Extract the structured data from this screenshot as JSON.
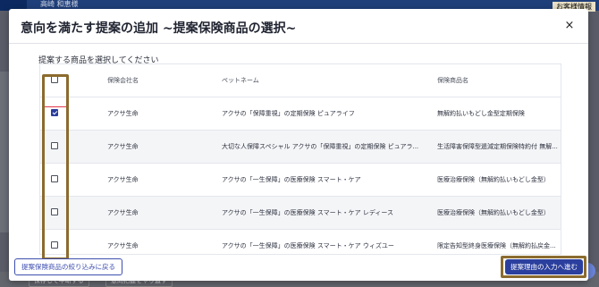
{
  "background": {
    "user_name": "高崎 和恵様",
    "right_badge": "お客様情報",
    "bottom_button_1": "保存して中断する",
    "bottom_button_2": "意向把握をやり直す"
  },
  "modal": {
    "title": "意向を満たす提案の追加 ~提案保険商品の選択~",
    "close_label": "×",
    "instruction": "提案する商品を選択してください",
    "columns": [
      "保険会社名",
      "ペットネーム",
      "保険商品名"
    ],
    "rows": [
      {
        "checked": true,
        "company": "アクサ生命",
        "petname": "アクサの「保障重視」の定期保険 ピュアライフ",
        "product": "無解約払いもどし金型定期保険"
      },
      {
        "checked": false,
        "company": "アクサ生命",
        "petname": "大切な人保障スペシャル アクサの「保障重視」の定期保険 ピュアラ...",
        "product": "生活障害保障型逓減定期保険特約付 無解..."
      },
      {
        "checked": false,
        "company": "アクサ生命",
        "petname": "アクサの「一生保障」の医療保険 スマート・ケア",
        "product": "医療治療保険（無解約払いもどし金型）"
      },
      {
        "checked": false,
        "company": "アクサ生命",
        "petname": "アクサの「一生保障」の医療保険 スマート・ケア レディース",
        "product": "医療治療保険（無解約払いもどし金型）"
      },
      {
        "checked": false,
        "company": "アクサ生命",
        "petname": "アクサの「一生保障」の医療保険 スマート・ケア ウィズユー",
        "product": "限定告知型終身医療保険（無解約払戻金..."
      }
    ],
    "back_button": "提案保険商品の絞り込みに戻る",
    "next_button": "提案理由の入力へ進む"
  }
}
